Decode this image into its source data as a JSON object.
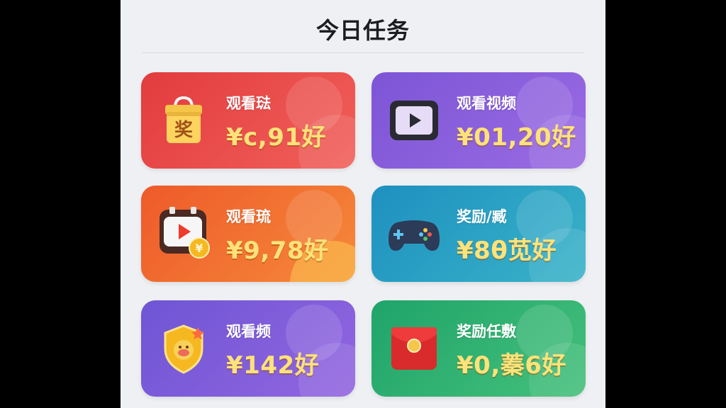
{
  "page": {
    "title": "今日任务"
  },
  "tasks": [
    {
      "label": "观看琺",
      "amount": "¥ᴄ,91好",
      "icon": "gift-bag-icon",
      "color": "#e23c3e"
    },
    {
      "label": "观看视频",
      "amount": "¥01,20好",
      "icon": "video-player-icon",
      "color": "#7c55d6"
    },
    {
      "label": "观看琉",
      "amount": "¥9,78好",
      "icon": "video-coin-icon",
      "color": "#ee5a2a"
    },
    {
      "label": "奖励/臧",
      "amount": "¥8θ苋好",
      "icon": "gamepad-icon",
      "color": "#1e90c0"
    },
    {
      "label": "观看频",
      "amount": "¥142好",
      "icon": "badge-icon",
      "color": "#6e55d4"
    },
    {
      "label": "奖励任敷",
      "amount": "¥0,蓁6好",
      "icon": "red-envelope-icon",
      "color": "#1fa46a"
    }
  ]
}
